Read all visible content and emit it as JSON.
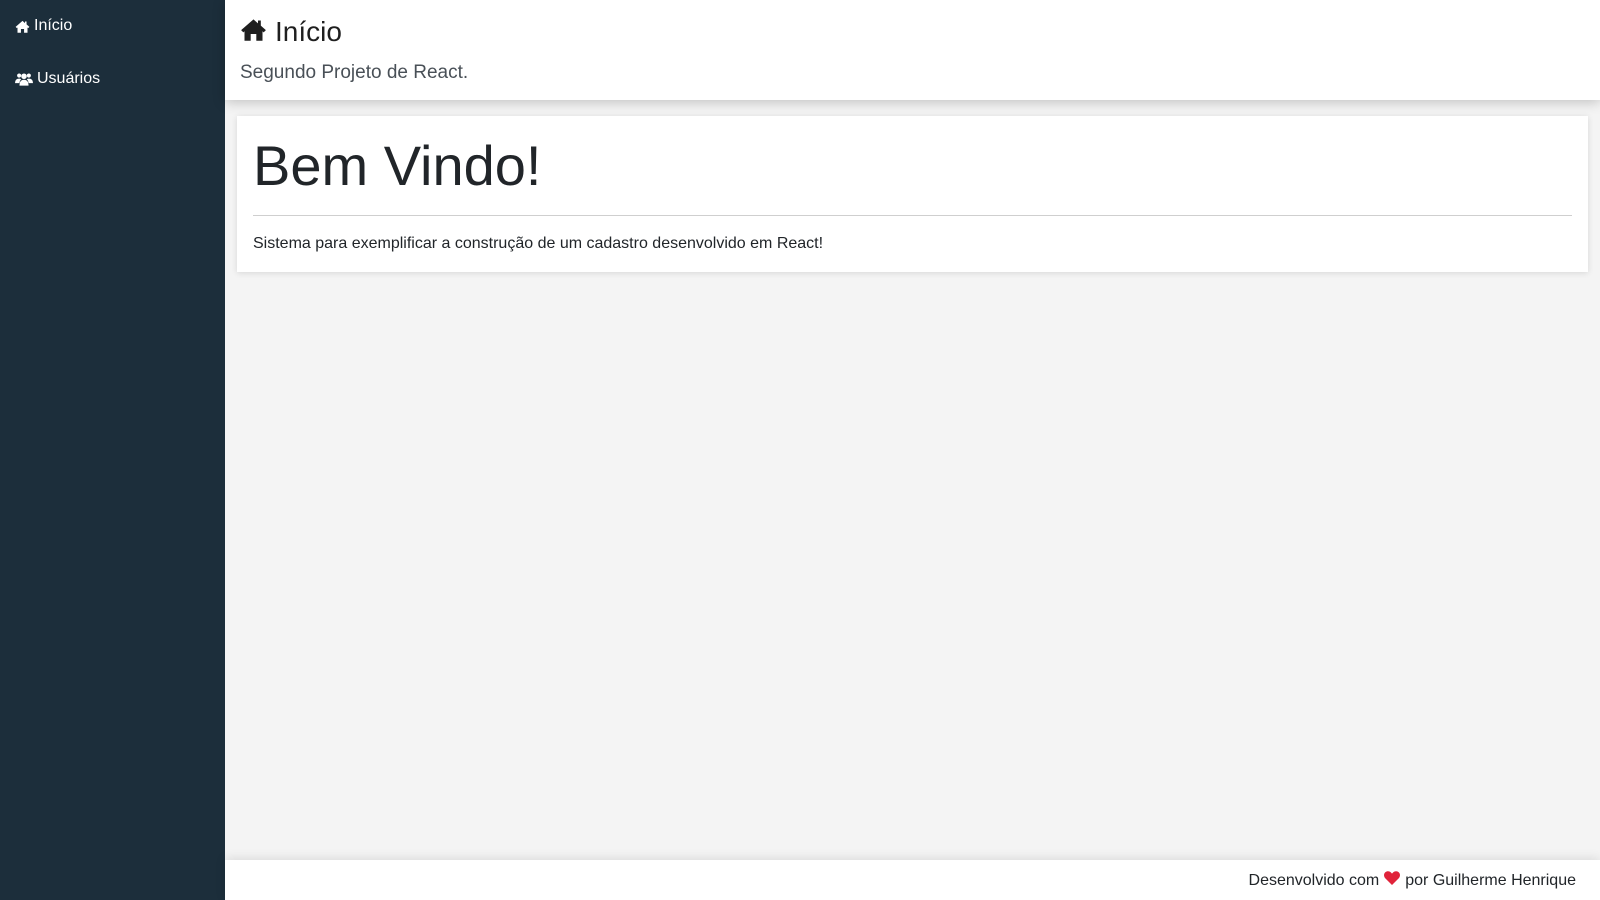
{
  "sidebar": {
    "items": [
      {
        "label": "Início",
        "icon": "home-icon"
      },
      {
        "label": "Usuários",
        "icon": "users-icon"
      }
    ]
  },
  "header": {
    "title": "Início",
    "title_icon": "home-icon",
    "subtitle": "Segundo Projeto de React."
  },
  "main": {
    "card": {
      "heading": "Bem Vindo!",
      "text": "Sistema para exemplificar a construção de um cadastro desenvolvido em React!"
    }
  },
  "footer": {
    "prefix": "Desenvolvido com",
    "icon": "heart-icon",
    "suffix": "por Guilherme Henrique"
  },
  "colors": {
    "sidebar_bg": "#1c2e3b",
    "content_bg": "#f4f4f4",
    "heart": "#e0233a"
  }
}
